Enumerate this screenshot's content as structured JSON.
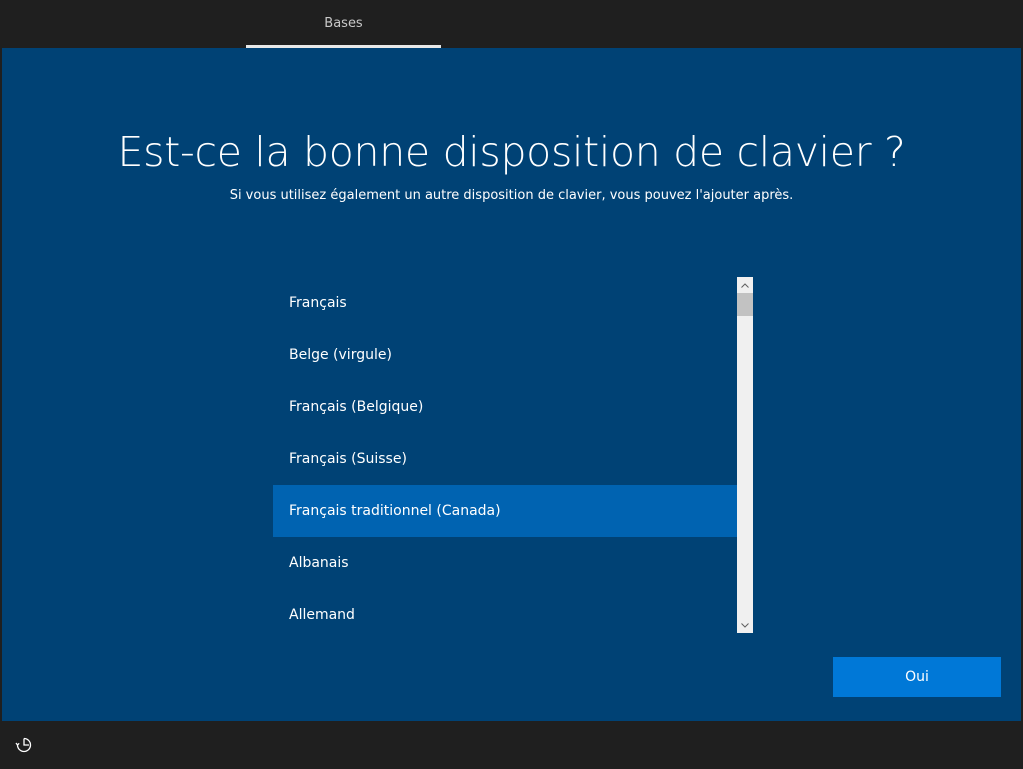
{
  "header": {
    "tab_label": "Bases"
  },
  "main": {
    "title": "Est-ce la bonne disposition de clavier ?",
    "subtitle": "Si vous utilisez également un autre disposition de clavier, vous pouvez l'ajouter après.",
    "layouts": [
      "Français",
      "Belge (virgule)",
      "Français (Belgique)",
      "Français (Suisse)",
      "Français traditionnel (Canada)",
      "Albanais",
      "Allemand"
    ],
    "selected_layout": "Français traditionnel (Canada)",
    "confirm_label": "Oui"
  },
  "icons": {
    "scroll_up": "chevron-up-icon",
    "scroll_down": "chevron-down-icon",
    "accessibility": "ease-of-access-icon"
  },
  "colors": {
    "background": "#004275",
    "selected": "#0063b1",
    "button": "#0078d7",
    "frame": "#1f1f1f"
  }
}
